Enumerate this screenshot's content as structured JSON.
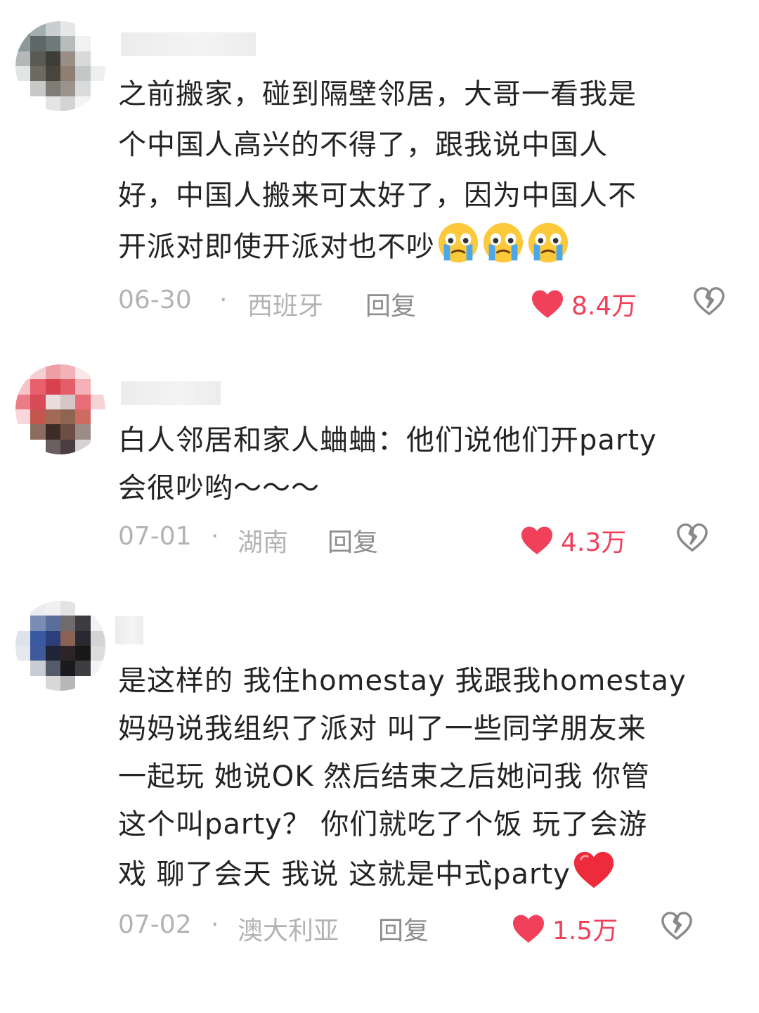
{
  "comments": [
    {
      "username": "",
      "lines": [
        "之前搬家，碰到隔壁邻居，大哥一看我是",
        "个中国人高兴的不得了，跟我说中国人",
        "好，中国人搬来可太好了，因为中国人不",
        "开派对即使开派对也不吵"
      ],
      "emoji_trail": [
        "crying-face",
        "crying-face",
        "crying-face"
      ],
      "date": "06-30",
      "separator": "·",
      "location": "西班牙",
      "reply_label": "回复",
      "likes": "8.4万"
    },
    {
      "username": "",
      "lines": [
        "白人邻居和家人蛐蛐：他们说他们开party",
        "会很吵哟～～～"
      ],
      "emoji_trail": [],
      "date": "07-01",
      "separator": "·",
      "location": "湖南",
      "reply_label": "回复",
      "likes": "4.3万"
    },
    {
      "username": "",
      "lines": [
        "是这样的 我住homestay 我跟我homestay",
        "妈妈说我组织了派对 叫了一些同学朋友来",
        "一起玩 她说OK 然后结束之后她问我 你管",
        "这个叫party？ 你们就吃了个饭 玩了会游",
        "戏 聊了会天 我说 这就是中式party"
      ],
      "emoji_trail": [
        "red-heart"
      ],
      "date": "07-02",
      "separator": "·",
      "location": "澳大利亚",
      "reply_label": "回复",
      "likes": "1.5万"
    }
  ],
  "colors": {
    "like_red": "#f0405a",
    "meta_gray": "#b3b3b3",
    "reply_gray": "#8e8e8e",
    "text": "#232323"
  },
  "icons": {
    "like": "heart-filled-icon",
    "dislike": "broken-heart-icon"
  }
}
